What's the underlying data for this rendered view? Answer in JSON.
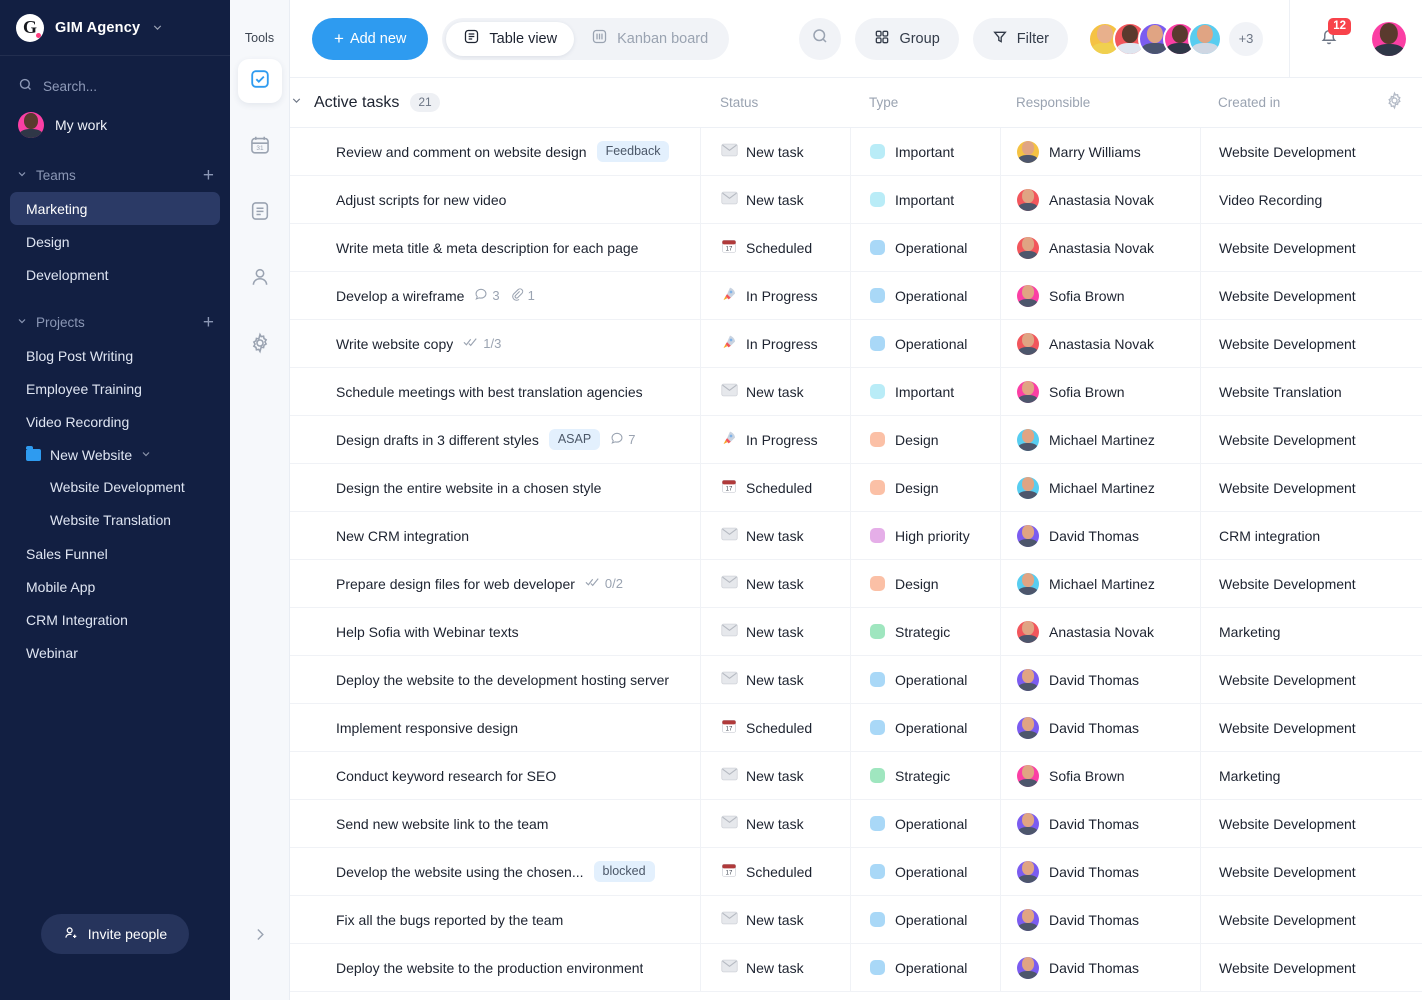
{
  "sidebar": {
    "brand": {
      "logo_letter": "G",
      "name": "GIM Agency",
      "chevron_icon": "chevron-down-icon"
    },
    "search": {
      "placeholder": "Search...",
      "icon": "search-icon"
    },
    "my_work": {
      "label": "My work"
    },
    "teams": {
      "label": "Teams",
      "add_label": "+",
      "items": [
        {
          "label": "Marketing",
          "active": true
        },
        {
          "label": "Design",
          "active": false
        },
        {
          "label": "Development",
          "active": false
        }
      ]
    },
    "projects": {
      "label": "Projects",
      "add_label": "+",
      "items": [
        {
          "label": "Blog Post Writing",
          "type": "plain"
        },
        {
          "label": "Employee Training",
          "type": "plain"
        },
        {
          "label": "Video Recording",
          "type": "plain"
        },
        {
          "label": "New Website",
          "type": "folder"
        },
        {
          "label": "Website Development",
          "type": "sub"
        },
        {
          "label": "Website Translation",
          "type": "sub"
        },
        {
          "label": "Sales Funnel",
          "type": "plain"
        },
        {
          "label": "Mobile App",
          "type": "plain"
        },
        {
          "label": "CRM Integration",
          "type": "plain"
        },
        {
          "label": "Webinar",
          "type": "plain"
        }
      ]
    },
    "invite": {
      "label": "Invite people",
      "icon": "add-person-icon"
    }
  },
  "tools": {
    "title": "Tools",
    "items": [
      {
        "name": "tasks",
        "icon": "check-square-icon",
        "active": true
      },
      {
        "name": "calendar",
        "icon": "calendar-icon",
        "active": false
      },
      {
        "name": "documents",
        "icon": "document-icon",
        "active": false
      },
      {
        "name": "contacts",
        "icon": "person-icon",
        "active": false
      },
      {
        "name": "settings",
        "icon": "gear-icon",
        "active": false
      }
    ],
    "expand_icon": "chevron-right-icon"
  },
  "toolbar": {
    "add_new_label": "Add new",
    "add_new_plus": "+",
    "views": [
      {
        "label": "Table view",
        "icon": "table-icon",
        "active": true
      },
      {
        "label": "Kanban board",
        "icon": "kanban-icon",
        "active": false
      }
    ],
    "search_icon": "search-icon",
    "group_label": "Group",
    "group_icon": "grid-icon",
    "filter_label": "Filter",
    "filter_icon": "funnel-icon",
    "avatars_overflow": "+3",
    "notifications_count": "12",
    "bell_icon": "bell-icon"
  },
  "table": {
    "group_label": "Active tasks",
    "group_count": "21",
    "collapse_icon": "chevron-down-icon",
    "settings_icon": "gear-icon",
    "columns": [
      "",
      "Status",
      "Type",
      "Responsible",
      "Created in"
    ],
    "rows": [
      {
        "task": "Review and comment on website design",
        "tag": "Feedback",
        "meta": [],
        "status": "New task",
        "status_icon": "envelope",
        "type": "Important",
        "type_color": "#b9ecf7",
        "responsible": "Marry Williams",
        "avatar_bg": "#f5c243",
        "project": "Website Development"
      },
      {
        "task": "Adjust scripts for new video",
        "tag": "",
        "meta": [],
        "status": "New task",
        "status_icon": "envelope",
        "type": "Important",
        "type_color": "#b9ecf7",
        "responsible": "Anastasia Novak",
        "avatar_bg": "#f2565c",
        "project": "Video Recording"
      },
      {
        "task": "Write meta title & meta description for each page",
        "tag": "",
        "meta": [],
        "status": "Scheduled",
        "status_icon": "calendar",
        "type": "Operational",
        "type_color": "#a9d8f7",
        "responsible": "Anastasia Novak",
        "avatar_bg": "#f2565c",
        "project": "Website Development"
      },
      {
        "task": "Develop a wireframe",
        "tag": "",
        "meta": [
          {
            "icon": "comment-icon",
            "value": "3"
          },
          {
            "icon": "attachment-icon",
            "value": "1"
          }
        ],
        "status": "In Progress",
        "status_icon": "rocket",
        "type": "Operational",
        "type_color": "#a9d8f7",
        "responsible": "Sofia Brown",
        "avatar_bg": "#fb3fa4",
        "project": "Website Development"
      },
      {
        "task": "Write website copy",
        "tag": "",
        "meta": [
          {
            "icon": "checklist-icon",
            "value": "1/3"
          }
        ],
        "status": "In Progress",
        "status_icon": "rocket",
        "type": "Operational",
        "type_color": "#a9d8f7",
        "responsible": "Anastasia Novak",
        "avatar_bg": "#f2565c",
        "project": "Website Development"
      },
      {
        "task": "Schedule meetings with best translation agencies",
        "tag": "",
        "meta": [],
        "status": "New task",
        "status_icon": "envelope",
        "type": "Important",
        "type_color": "#b9ecf7",
        "responsible": "Sofia Brown",
        "avatar_bg": "#fb3fa4",
        "project": "Website Translation"
      },
      {
        "task": "Design drafts in 3 different styles",
        "tag": "ASAP",
        "meta": [
          {
            "icon": "comment-icon",
            "value": "7"
          }
        ],
        "status": "In Progress",
        "status_icon": "rocket",
        "type": "Design",
        "type_color": "#fbc0a6",
        "responsible": "Michael Martinez",
        "avatar_bg": "#58cdf0",
        "project": "Website Development"
      },
      {
        "task": "Design the entire website in a chosen style",
        "tag": "",
        "meta": [],
        "status": "Scheduled",
        "status_icon": "calendar",
        "type": "Design",
        "type_color": "#fbc0a6",
        "responsible": "Michael Martinez",
        "avatar_bg": "#58cdf0",
        "project": "Website Development"
      },
      {
        "task": "New CRM integration",
        "tag": "",
        "meta": [],
        "status": "New task",
        "status_icon": "envelope",
        "type": "High priority",
        "type_color": "#e5aee8",
        "responsible": "David Thomas",
        "avatar_bg": "#7b5cf0",
        "project": "CRM integration"
      },
      {
        "task": "Prepare design files for web developer",
        "tag": "",
        "meta": [
          {
            "icon": "checklist-icon",
            "value": "0/2"
          }
        ],
        "status": "New task",
        "status_icon": "envelope",
        "type": "Design",
        "type_color": "#fbc0a6",
        "responsible": "Michael Martinez",
        "avatar_bg": "#58cdf0",
        "project": "Website Development"
      },
      {
        "task": "Help Sofia with Webinar texts",
        "tag": "",
        "meta": [],
        "status": "New task",
        "status_icon": "envelope",
        "type": "Strategic",
        "type_color": "#9fe6bf",
        "responsible": "Anastasia Novak",
        "avatar_bg": "#f2565c",
        "project": "Marketing"
      },
      {
        "task": "Deploy the website to the development hosting server",
        "tag": "",
        "meta": [],
        "status": "New task",
        "status_icon": "envelope",
        "type": "Operational",
        "type_color": "#a9d8f7",
        "responsible": "David Thomas",
        "avatar_bg": "#7b5cf0",
        "project": "Website Development"
      },
      {
        "task": "Implement responsive design",
        "tag": "",
        "meta": [],
        "status": "Scheduled",
        "status_icon": "calendar",
        "type": "Operational",
        "type_color": "#a9d8f7",
        "responsible": "David Thomas",
        "avatar_bg": "#7b5cf0",
        "project": "Website Development"
      },
      {
        "task": "Conduct keyword research for SEO",
        "tag": "",
        "meta": [],
        "status": "New task",
        "status_icon": "envelope",
        "type": "Strategic",
        "type_color": "#9fe6bf",
        "responsible": "Sofia Brown",
        "avatar_bg": "#fb3fa4",
        "project": "Marketing"
      },
      {
        "task": "Send new website link to the team",
        "tag": "",
        "meta": [],
        "status": "New task",
        "status_icon": "envelope",
        "type": "Operational",
        "type_color": "#a9d8f7",
        "responsible": "David Thomas",
        "avatar_bg": "#7b5cf0",
        "project": "Website Development"
      },
      {
        "task": "Develop the website using the chosen...",
        "tag": "blocked",
        "meta": [],
        "status": "Scheduled",
        "status_icon": "calendar",
        "type": "Operational",
        "type_color": "#a9d8f7",
        "responsible": "David Thomas",
        "avatar_bg": "#7b5cf0",
        "project": "Website Development"
      },
      {
        "task": "Fix all the bugs reported by the team",
        "tag": "",
        "meta": [],
        "status": "New task",
        "status_icon": "envelope",
        "type": "Operational",
        "type_color": "#a9d8f7",
        "responsible": "David Thomas",
        "avatar_bg": "#7b5cf0",
        "project": "Website Development"
      },
      {
        "task": "Deploy the website to the production environment",
        "tag": "",
        "meta": [],
        "status": "New task",
        "status_icon": "envelope",
        "type": "Operational",
        "type_color": "#a9d8f7",
        "responsible": "David Thomas",
        "avatar_bg": "#7b5cf0",
        "project": "Website Development"
      }
    ]
  },
  "colors": {
    "accent": "#2e9bf0",
    "sidebar_bg": "#121f42",
    "sidebar_active": "#2b3a66",
    "badge_red": "#f8434b"
  }
}
